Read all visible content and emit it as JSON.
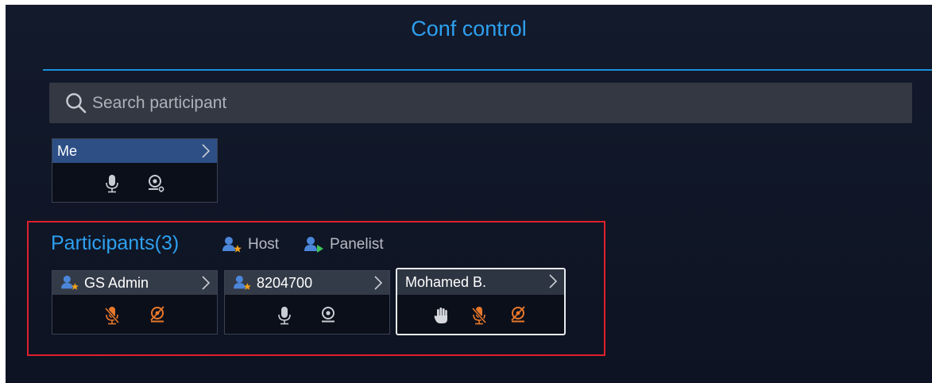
{
  "header": {
    "title": "Conf control"
  },
  "search": {
    "placeholder": "Search participant"
  },
  "me_card": {
    "name": "Me"
  },
  "participants": {
    "title": "Participants(3)",
    "legend": {
      "host": "Host",
      "panelist": "Panelist"
    },
    "list": [
      {
        "name": "GS Admin",
        "role": "host",
        "mic": "muted",
        "camera": "off"
      },
      {
        "name": "8204700",
        "role": "host",
        "mic": "on",
        "camera": "on"
      },
      {
        "name": "Mohamed B.",
        "role": "none",
        "hand_raised": true,
        "mic": "muted",
        "camera": "off",
        "selected": true
      }
    ]
  },
  "colors": {
    "accent": "#2ea0f0",
    "muted_icon": "#e8782a",
    "highlight_box": "#e01f2c",
    "me_header": "#2d4f86"
  }
}
